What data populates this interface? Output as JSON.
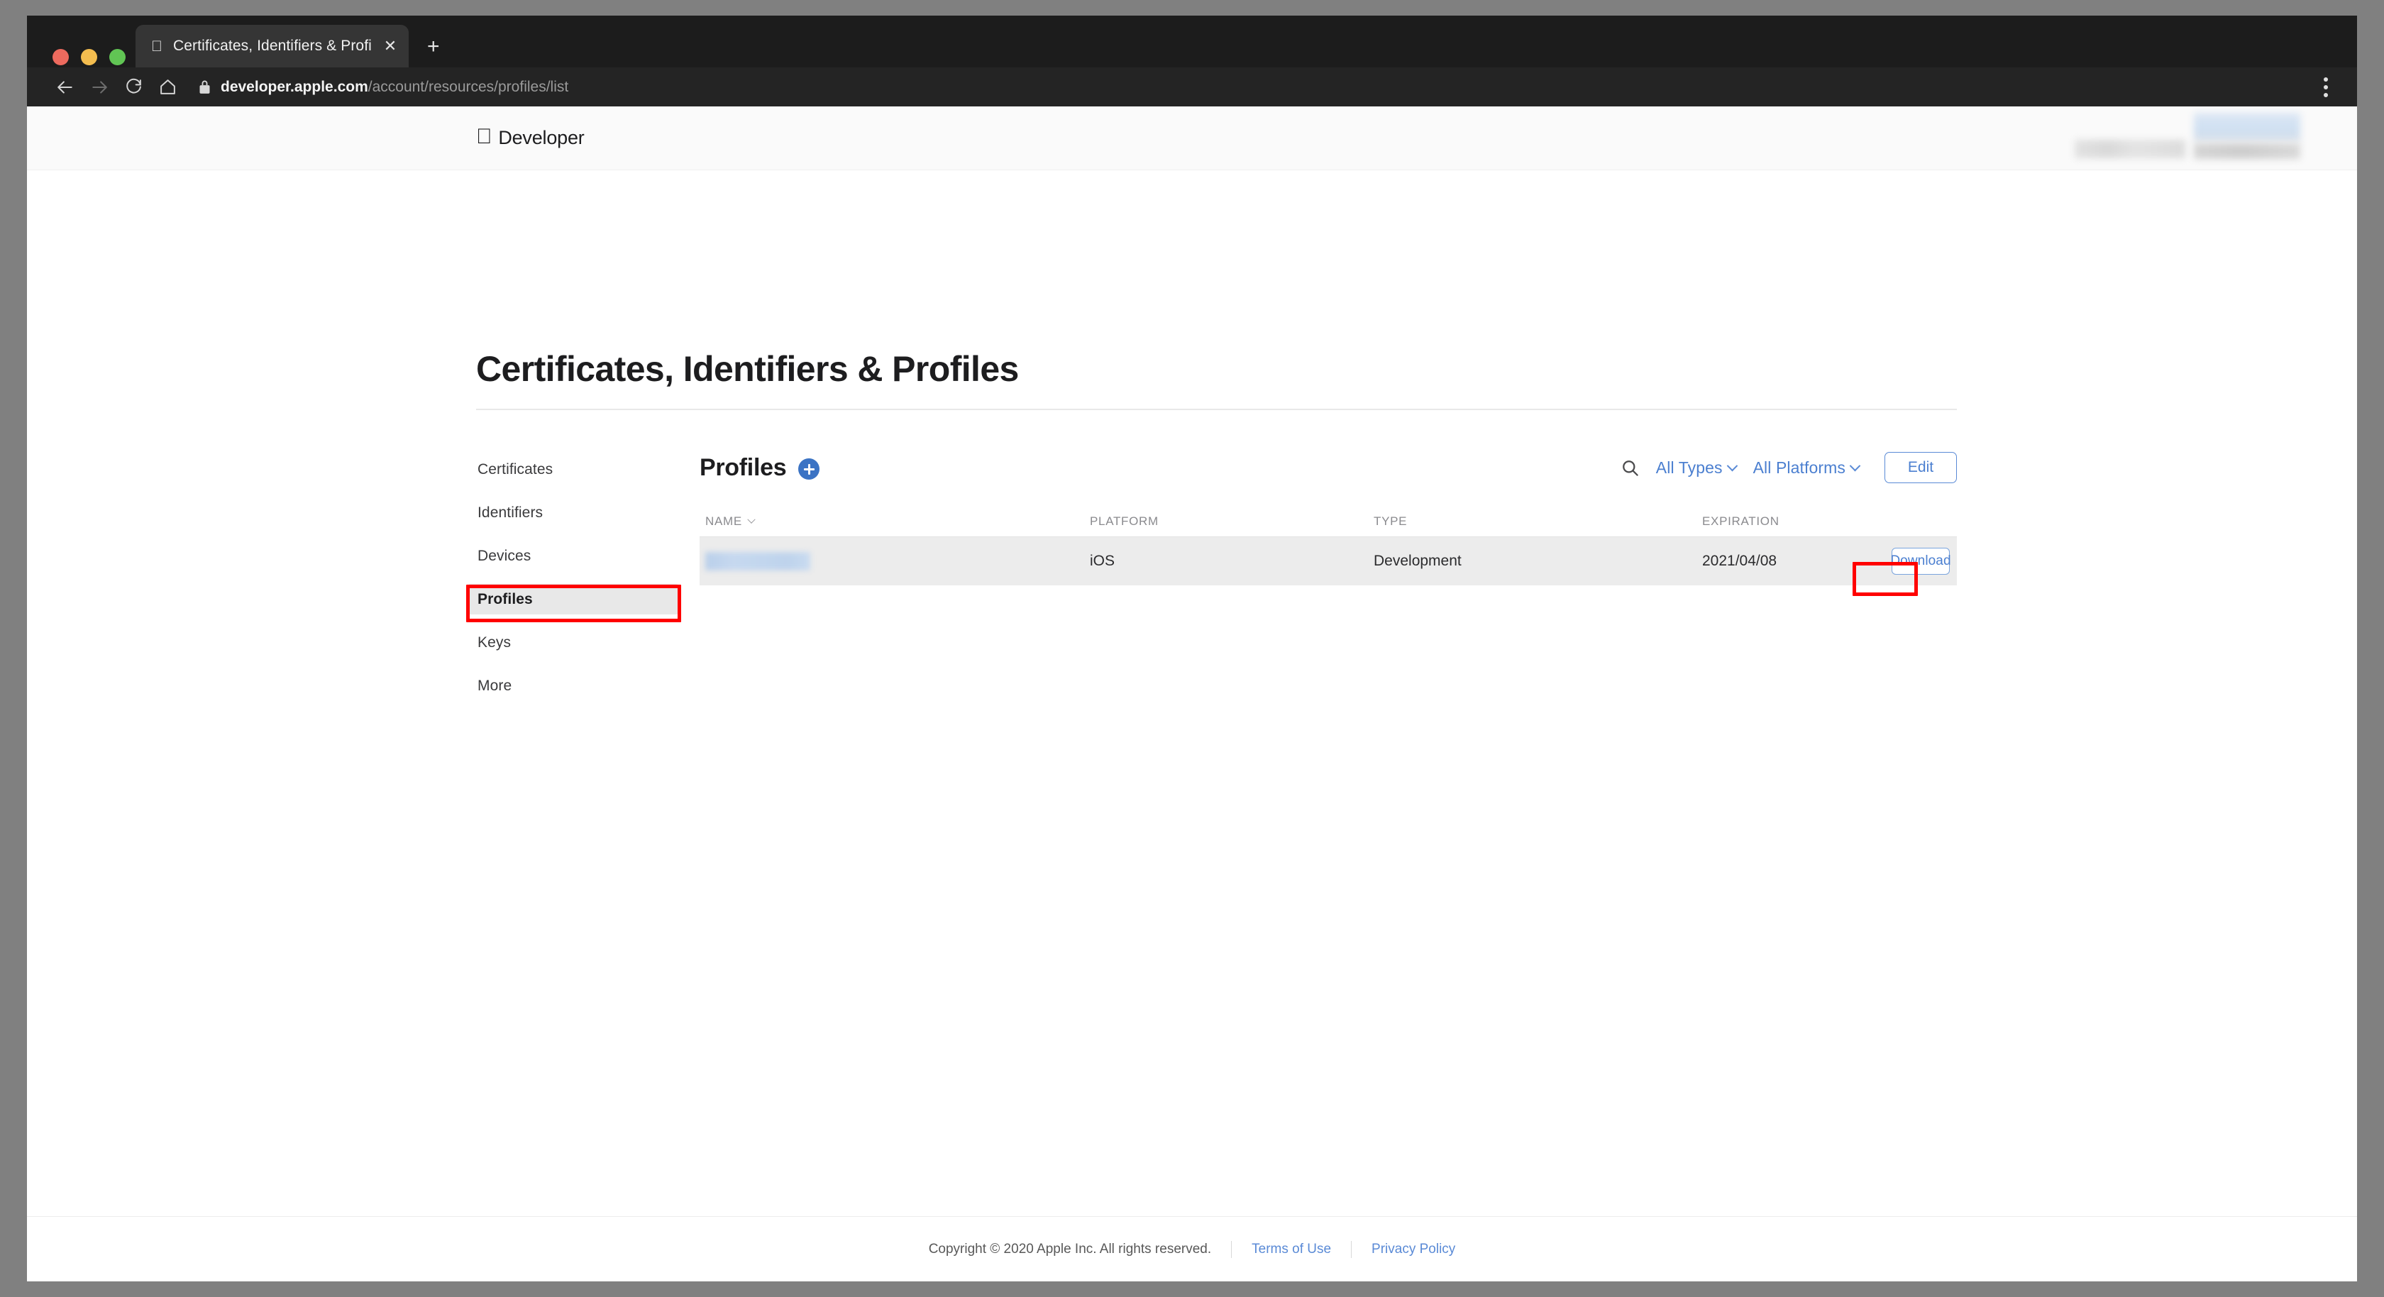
{
  "browser": {
    "tab": {
      "title": "Certificates, Identifiers & Profiles",
      "favicon": "apple-icon",
      "close_label": "✕"
    },
    "new_tab_label": "+",
    "nav": {
      "back": "back-arrow-icon",
      "forward": "forward-arrow-icon",
      "reload": "reload-icon",
      "home": "home-icon"
    },
    "address": {
      "lock": "lock-icon",
      "host": "developer.apple.com",
      "path": "/account/resources/profiles/list",
      "full_url": "developer.apple.com/account/resources/profiles/list"
    },
    "menu_label": "browser-menu-icon"
  },
  "header": {
    "apple_glyph": "",
    "brand": "Developer",
    "account_redacted_1": "",
    "account_redacted_2": "",
    "account_redacted_3": ""
  },
  "page": {
    "title": "Certificates, Identifiers & Profiles"
  },
  "sidebar": {
    "items": [
      {
        "label": "Certificates",
        "active": false
      },
      {
        "label": "Identifiers",
        "active": false
      },
      {
        "label": "Devices",
        "active": false
      },
      {
        "label": "Profiles",
        "active": true
      },
      {
        "label": "Keys",
        "active": false
      },
      {
        "label": "More",
        "active": false
      }
    ]
  },
  "panel": {
    "title": "Profiles",
    "add_label": "add-profile",
    "search_label": "search-icon",
    "filters": [
      {
        "label": "All Types"
      },
      {
        "label": "All Platforms"
      }
    ],
    "edit_label": "Edit"
  },
  "table": {
    "columns": [
      "NAME",
      "PLATFORM",
      "TYPE",
      "EXPIRATION"
    ],
    "sort_column": "NAME",
    "rows": [
      {
        "name": "",
        "name_redacted": true,
        "platform": "iOS",
        "type": "Development",
        "expiration": "2021/04/08",
        "action": "Download"
      }
    ]
  },
  "footer": {
    "copyright": "Copyright © 2020 Apple Inc. All rights reserved.",
    "links": [
      "Terms of Use",
      "Privacy Policy"
    ]
  },
  "annotations": {
    "accent_color": "#ff0000",
    "boxes": [
      "sidebar-profiles",
      "row-download-button"
    ]
  },
  "colors": {
    "link_blue": "#4b7fd0",
    "add_button_blue": "#3b73c4",
    "annotation_red": "#ff0000",
    "row_background": "#ececec",
    "header_background": "#fafafa"
  }
}
